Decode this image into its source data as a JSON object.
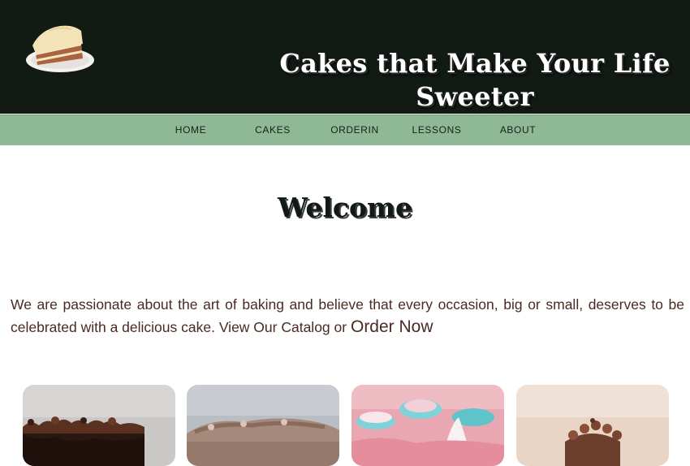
{
  "header": {
    "title": "Cakes that Make Your Life Sweeter",
    "logo_icon": "cake-slice-icon"
  },
  "nav": {
    "items": [
      {
        "label": "HOME"
      },
      {
        "label": "CAKES"
      },
      {
        "label": "ORDERIN"
      },
      {
        "label": "LESSONS"
      },
      {
        "label": "ABOUT"
      }
    ]
  },
  "main": {
    "heading": "Welcome",
    "intro_text": "We are passionate about the art of baking and believe that every occasion, big or small, deserves to be celebrated with a delicious cake.",
    "catalog_link": "View Our Catalog",
    "connector": "or",
    "order_link": "Order Now"
  },
  "colors": {
    "header_bg": "#111b14",
    "nav_bg": "#8fb995",
    "text_brown": "#4a2a24"
  },
  "cards": [
    {
      "name": "chocolate-cake-card"
    },
    {
      "name": "frosted-cake-card"
    },
    {
      "name": "macaron-cake-card"
    },
    {
      "name": "cupcake-tower-card"
    }
  ]
}
